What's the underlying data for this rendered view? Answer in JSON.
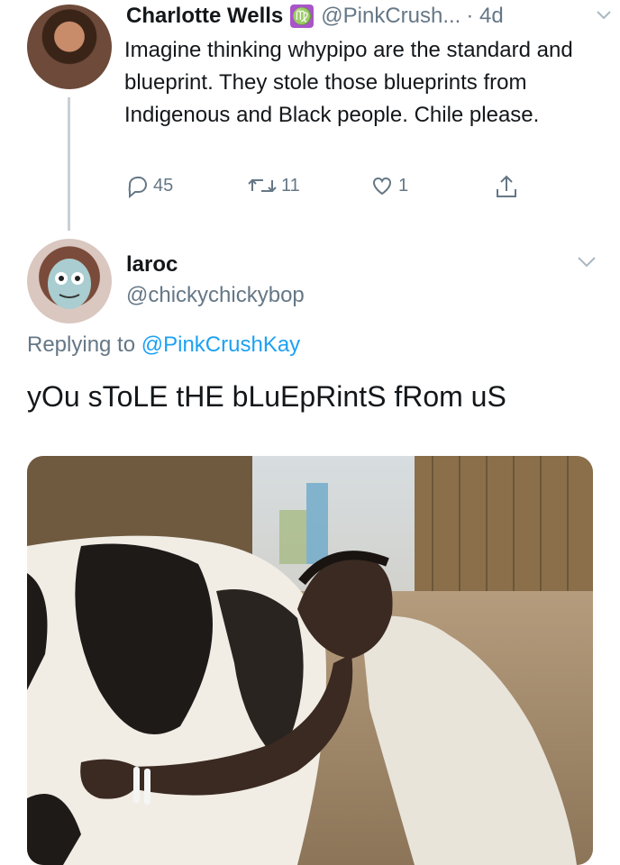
{
  "tweet1": {
    "name": "Charlotte Wells",
    "badge": "♍",
    "handle": "@PinkCrush...",
    "time": "· 4d",
    "text": "Imagine thinking whypipo are the standard and blueprint. They stole those blueprints from Indigenous and Black people. Chile please.",
    "reply_count": "45",
    "retweet_count": "11",
    "like_count": "1"
  },
  "tweet2": {
    "name": "laroc",
    "handle": "@chickychickybop",
    "replying_prefix": "Replying to",
    "replying_handle": "@PinkCrushKay",
    "text": "yOu sToLE tHE bLuEpRintS fRom uS"
  },
  "icons": {
    "reply": "reply-icon",
    "retweet": "retweet-icon",
    "like": "heart-icon",
    "share": "share-icon",
    "more": "chevron-down-icon"
  },
  "colors": {
    "text": "#14171a",
    "muted": "#657786",
    "link": "#1da1f2",
    "thread_line": "#c8d0d6",
    "virgo_badge": "#a855c9"
  }
}
